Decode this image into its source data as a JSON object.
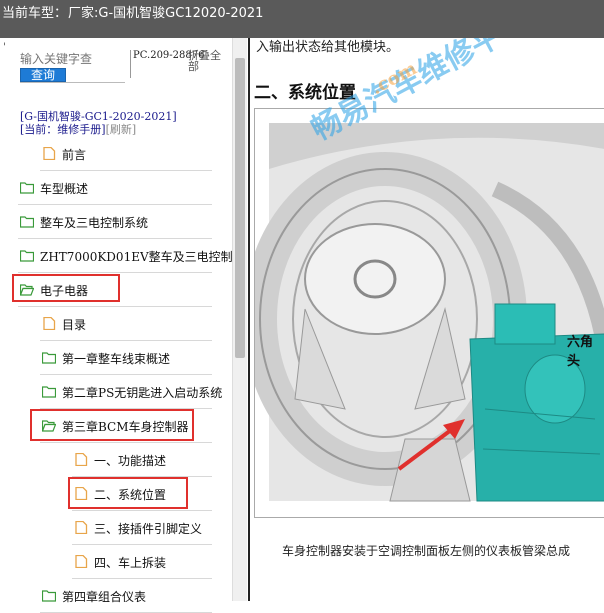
{
  "header": {
    "label": "当前车型：",
    "value": "厂家:G-国机智骏GC12020-2021"
  },
  "sidebar": {
    "search_placeholder": "输入关键字查",
    "search_button": "查询",
    "doc_code": "PC.209-28876",
    "collapse_all": "折叠全部",
    "breadcrumb_model": "[G-国机智骏-GC1-2020-2021]",
    "breadcrumb_current": "[当前：维修手册]",
    "breadcrumb_refresh": "[刷新]",
    "items": [
      {
        "label": "前言",
        "type": "file"
      },
      {
        "label": "车型概述",
        "type": "folder"
      },
      {
        "label": "整车及三电控制系统",
        "type": "folder"
      },
      {
        "label": "ZHT7000KD01EV整车及三电控制",
        "type": "folder"
      },
      {
        "label": "电子电器",
        "type": "folder-open",
        "highlighted": true
      },
      {
        "label": "目录",
        "type": "file"
      },
      {
        "label": "第一章整车线束概述",
        "type": "folder"
      },
      {
        "label": "第二章PS无钥匙进入启动系统",
        "type": "folder"
      },
      {
        "label": "第三章BCM车身控制器",
        "type": "folder-open",
        "highlighted": true
      },
      {
        "label": "一、功能描述",
        "type": "file"
      },
      {
        "label": "二、系统位置",
        "type": "file",
        "highlighted": true,
        "selected": true
      },
      {
        "label": "三、接插件引脚定义",
        "type": "file"
      },
      {
        "label": "四、车上拆装",
        "type": "file"
      },
      {
        "label": "第四章组合仪表",
        "type": "folder"
      }
    ]
  },
  "content": {
    "prev_text": "入输出状态给其他模块。",
    "section_title": "二、系统位置",
    "figure_label": "六角头",
    "caption": "车身控制器安装于空调控制面板左侧的仪表板管梁总成",
    "watermark": "畅易汽车维修平",
    "watermark_url": ".com"
  },
  "colors": {
    "header_bg": "#5a5a5a",
    "button_blue": "#1e7bd6",
    "highlight_red": "#e0302d",
    "folder_green": "#3a9a3a",
    "file_orange": "#e8a54a",
    "module_teal": "#27b0a9"
  }
}
